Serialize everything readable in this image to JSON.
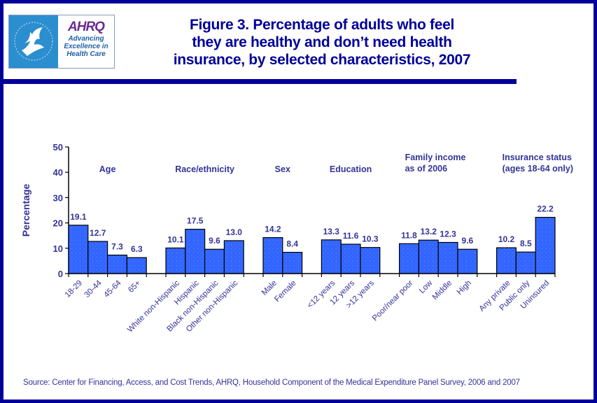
{
  "header": {
    "title_lines": [
      "Figure 3. Percentage of adults who feel",
      "they are healthy and don’t need health",
      "insurance, by selected characteristics, 2007"
    ],
    "logo": {
      "agency_icon": "hhs-eagle-icon",
      "brand": "AHRQ",
      "tagline_lines": [
        "Advancing",
        "Excellence in",
        "Health Care"
      ]
    }
  },
  "colors": {
    "frame": "#000099",
    "bar_fill": "#3366ff",
    "bar_stroke": "#000000",
    "text": "#333399"
  },
  "chart_data": {
    "type": "bar",
    "title": "Figure 3. Percentage of adults who feel they are healthy and don’t need health insurance, by selected characteristics, 2007",
    "xlabel": "",
    "ylabel": "Percentage",
    "ylim": [
      0,
      50
    ],
    "yticks": [
      0,
      10,
      20,
      30,
      40,
      50
    ],
    "grid": false,
    "groups": [
      {
        "label_lines": [
          "Age"
        ],
        "categories": [
          "18-29",
          "30-44",
          "45-64",
          "65+"
        ],
        "values": [
          19.1,
          12.7,
          7.3,
          6.3
        ],
        "value_labels": [
          "19.1",
          "12.7",
          "7.3",
          "6.3"
        ]
      },
      {
        "label_lines": [
          "Race/ethnicity"
        ],
        "categories": [
          "White non-Hispanic",
          "Hispanic",
          "Black non-Hispanic",
          "Other non-Hispanic"
        ],
        "values": [
          10.1,
          17.5,
          9.6,
          13.0
        ],
        "value_labels": [
          "10.1",
          "17.5",
          "9.6",
          "13.0"
        ]
      },
      {
        "label_lines": [
          "Sex"
        ],
        "categories": [
          "Male",
          "Female"
        ],
        "values": [
          14.2,
          8.4
        ],
        "value_labels": [
          "14.2",
          "8.4"
        ]
      },
      {
        "label_lines": [
          "Education"
        ],
        "categories": [
          "<12 years",
          "12 years",
          ">12 years"
        ],
        "values": [
          13.3,
          11.6,
          10.3
        ],
        "value_labels": [
          "13.3",
          "11.6",
          "10.3"
        ]
      },
      {
        "label_lines": [
          "Family income",
          "as of 2006"
        ],
        "categories": [
          "Poor/near poor",
          "Low",
          "Middle",
          "High"
        ],
        "values": [
          11.8,
          13.2,
          12.3,
          9.6
        ],
        "value_labels": [
          "11.8",
          "13.2",
          "12.3",
          "9.6"
        ]
      },
      {
        "label_lines": [
          "Insurance status",
          "(ages 18-64 only)"
        ],
        "categories": [
          "Any private",
          "Public only",
          "Uninsured"
        ],
        "values": [
          10.2,
          8.5,
          22.2
        ],
        "value_labels": [
          "10.2",
          "8.5",
          "22.2"
        ]
      }
    ]
  },
  "footer": {
    "source": "Source: Center for Financing, Access, and Cost Trends, AHRQ, Household Component of the Medical Expenditure Panel Survey,  2006 and 2007"
  }
}
